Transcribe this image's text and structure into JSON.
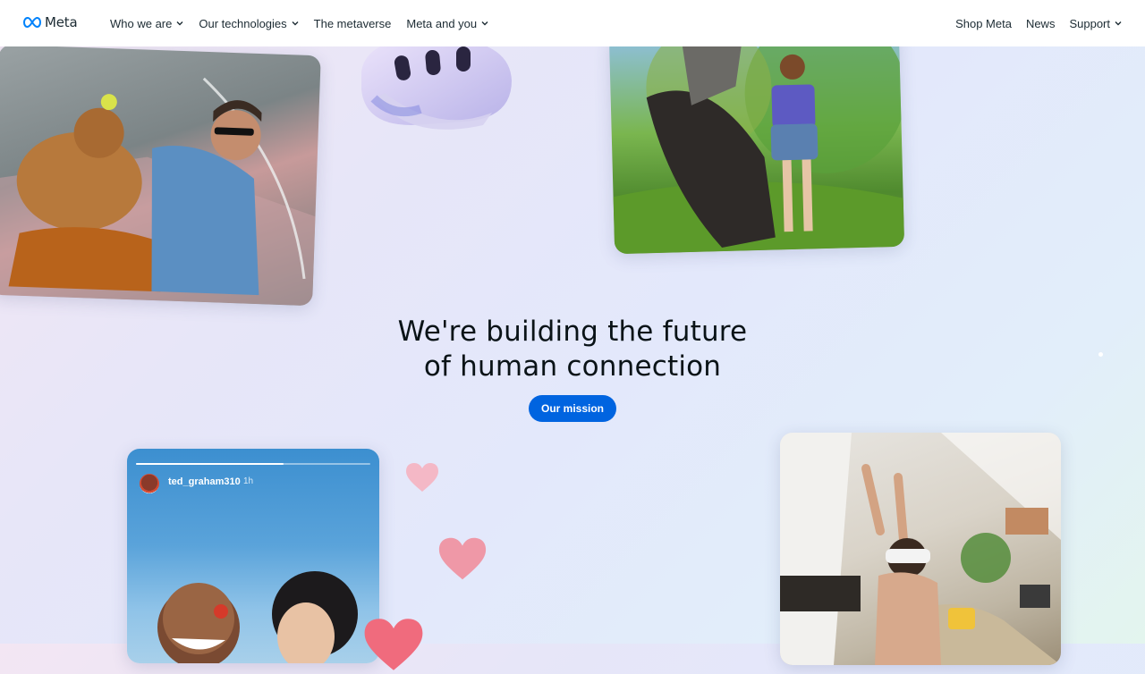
{
  "brand": {
    "name": "Meta",
    "logo_icon": "meta-infinity-logo",
    "logo_color": "#0082fb"
  },
  "nav": {
    "left": [
      {
        "label": "Who we are",
        "has_dropdown": true
      },
      {
        "label": "Our technologies",
        "has_dropdown": true
      },
      {
        "label": "The metaverse",
        "has_dropdown": false
      },
      {
        "label": "Meta and you",
        "has_dropdown": true
      }
    ],
    "right": [
      {
        "label": "Shop Meta",
        "has_dropdown": false
      },
      {
        "label": "News",
        "has_dropdown": false
      },
      {
        "label": "Support",
        "has_dropdown": true
      }
    ]
  },
  "hero": {
    "title_line1": "We're building the future",
    "title_line2": "of human connection",
    "cta_label": "Our mission"
  },
  "story_card": {
    "username": "ted_graham310",
    "time": "1h",
    "progress": 0.63
  },
  "colors": {
    "cta": "#0064e0",
    "heart_light": "#f4b8c6",
    "heart_mid": "#ef98a7",
    "heart_dark": "#f06b7d"
  }
}
